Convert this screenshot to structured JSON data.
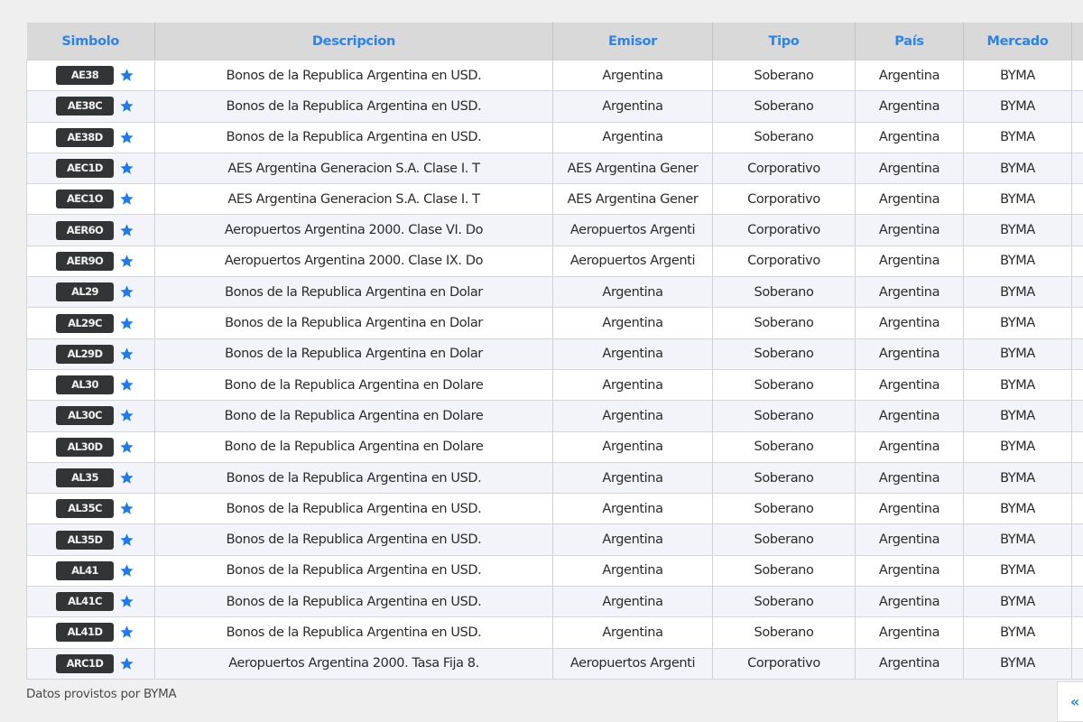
{
  "table": {
    "headers": [
      "Simbolo",
      "Descripcion",
      "Emisor",
      "Tipo",
      "País",
      "Mercado",
      ""
    ],
    "rows": [
      {
        "symbol": "AE38",
        "favorite_icon": "star-icon",
        "descripcion": "Bonos de la Republica Argentina en USD.",
        "emisor": "Argentina",
        "tipo": "Soberano",
        "pais": "Argentina",
        "mercado": "BYMA"
      },
      {
        "symbol": "AE38C",
        "favorite_icon": "star-icon",
        "descripcion": "Bonos de la Republica Argentina en USD.",
        "emisor": "Argentina",
        "tipo": "Soberano",
        "pais": "Argentina",
        "mercado": "BYMA"
      },
      {
        "symbol": "AE38D",
        "favorite_icon": "star-icon",
        "descripcion": "Bonos de la Republica Argentina en USD.",
        "emisor": "Argentina",
        "tipo": "Soberano",
        "pais": "Argentina",
        "mercado": "BYMA"
      },
      {
        "symbol": "AEC1D",
        "favorite_icon": "star-icon",
        "descripcion": "AES Argentina Generacion S.A. Clase I. T",
        "emisor": "AES Argentina Gener",
        "tipo": "Corporativo",
        "pais": "Argentina",
        "mercado": "BYMA"
      },
      {
        "symbol": "AEC1O",
        "favorite_icon": "star-icon",
        "descripcion": "AES Argentina Generacion S.A. Clase I. T",
        "emisor": "AES Argentina Gener",
        "tipo": "Corporativo",
        "pais": "Argentina",
        "mercado": "BYMA"
      },
      {
        "symbol": "AER6O",
        "favorite_icon": "star-icon",
        "descripcion": "Aeropuertos Argentina 2000. Clase VI. Do",
        "emisor": "Aeropuertos Argenti",
        "tipo": "Corporativo",
        "pais": "Argentina",
        "mercado": "BYMA"
      },
      {
        "symbol": "AER9O",
        "favorite_icon": "star-icon",
        "descripcion": "Aeropuertos Argentina 2000. Clase IX. Do",
        "emisor": "Aeropuertos Argenti",
        "tipo": "Corporativo",
        "pais": "Argentina",
        "mercado": "BYMA"
      },
      {
        "symbol": "AL29",
        "favorite_icon": "star-icon",
        "descripcion": "Bonos de la Republica Argentina en Dolar",
        "emisor": "Argentina",
        "tipo": "Soberano",
        "pais": "Argentina",
        "mercado": "BYMA"
      },
      {
        "symbol": "AL29C",
        "favorite_icon": "star-icon",
        "descripcion": "Bonos de la Republica Argentina en Dolar",
        "emisor": "Argentina",
        "tipo": "Soberano",
        "pais": "Argentina",
        "mercado": "BYMA"
      },
      {
        "symbol": "AL29D",
        "favorite_icon": "star-icon",
        "descripcion": "Bonos de la Republica Argentina en Dolar",
        "emisor": "Argentina",
        "tipo": "Soberano",
        "pais": "Argentina",
        "mercado": "BYMA"
      },
      {
        "symbol": "AL30",
        "favorite_icon": "star-icon",
        "descripcion": "Bono de la Republica Argentina en Dolare",
        "emisor": "Argentina",
        "tipo": "Soberano",
        "pais": "Argentina",
        "mercado": "BYMA"
      },
      {
        "symbol": "AL30C",
        "favorite_icon": "star-icon",
        "descripcion": "Bono de la Republica Argentina en Dolare",
        "emisor": "Argentina",
        "tipo": "Soberano",
        "pais": "Argentina",
        "mercado": "BYMA"
      },
      {
        "symbol": "AL30D",
        "favorite_icon": "star-icon",
        "descripcion": "Bono de la Republica Argentina en Dolare",
        "emisor": "Argentina",
        "tipo": "Soberano",
        "pais": "Argentina",
        "mercado": "BYMA"
      },
      {
        "symbol": "AL35",
        "favorite_icon": "star-icon",
        "descripcion": "Bonos de la Republica Argentina en USD.",
        "emisor": "Argentina",
        "tipo": "Soberano",
        "pais": "Argentina",
        "mercado": "BYMA"
      },
      {
        "symbol": "AL35C",
        "favorite_icon": "star-icon",
        "descripcion": "Bonos de la Republica Argentina en USD.",
        "emisor": "Argentina",
        "tipo": "Soberano",
        "pais": "Argentina",
        "mercado": "BYMA"
      },
      {
        "symbol": "AL35D",
        "favorite_icon": "star-icon",
        "descripcion": "Bonos de la Republica Argentina en USD.",
        "emisor": "Argentina",
        "tipo": "Soberano",
        "pais": "Argentina",
        "mercado": "BYMA"
      },
      {
        "symbol": "AL41",
        "favorite_icon": "star-icon",
        "descripcion": "Bonos de la Republica Argentina en USD.",
        "emisor": "Argentina",
        "tipo": "Soberano",
        "pais": "Argentina",
        "mercado": "BYMA"
      },
      {
        "symbol": "AL41C",
        "favorite_icon": "star-icon",
        "descripcion": "Bonos de la Republica Argentina en USD.",
        "emisor": "Argentina",
        "tipo": "Soberano",
        "pais": "Argentina",
        "mercado": "BYMA"
      },
      {
        "symbol": "AL41D",
        "favorite_icon": "star-icon",
        "descripcion": "Bonos de la Republica Argentina en USD.",
        "emisor": "Argentina",
        "tipo": "Soberano",
        "pais": "Argentina",
        "mercado": "BYMA"
      },
      {
        "symbol": "ARC1D",
        "favorite_icon": "star-icon",
        "descripcion": "Aeropuertos Argentina 2000. Tasa Fija 8.",
        "emisor": "Aeropuertos Argenti",
        "tipo": "Corporativo",
        "pais": "Argentina",
        "mercado": "BYMA"
      }
    ]
  },
  "footer": {
    "note": "Datos provistos por BYMA",
    "pager_prev_label": "«"
  },
  "colors": {
    "header_text": "#2b84e8",
    "header_bg": "#d9d9d9",
    "badge_bg": "#333436",
    "star": "#1a7cf0",
    "row_alt_bg": "#f3f3fa"
  }
}
